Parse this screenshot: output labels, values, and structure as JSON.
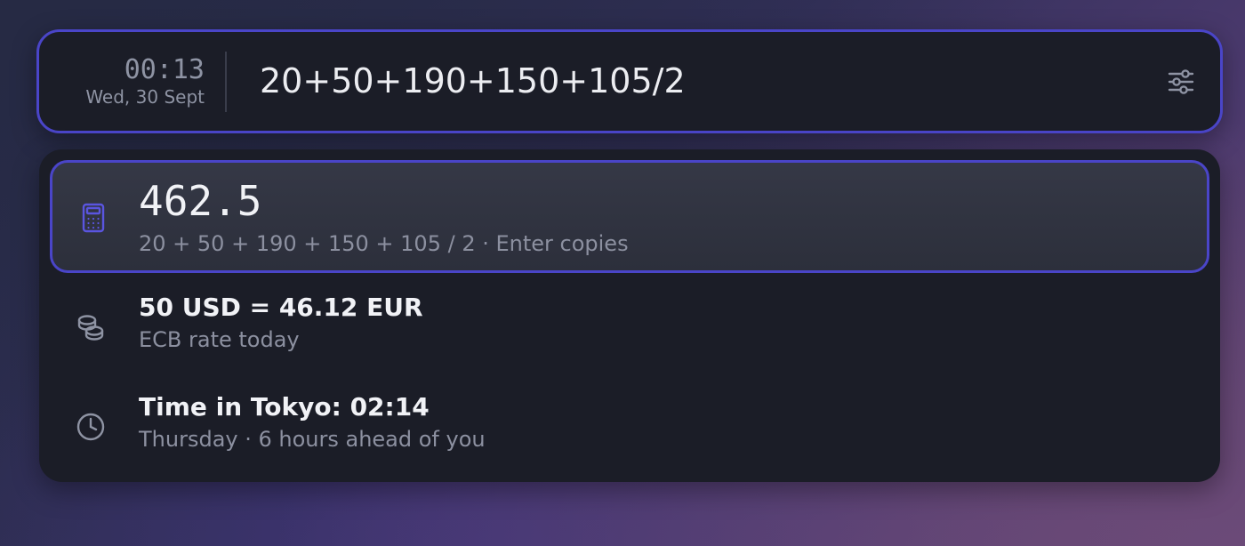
{
  "clock": {
    "time": "00:13",
    "date": "Wed, 30 Sept"
  },
  "search": {
    "query": "20+50+190+150+105/2",
    "settings_icon": "sliders-icon"
  },
  "results": [
    {
      "icon": "calculator-icon",
      "title": "462.5",
      "subtitle": "20 + 50 + 190 + 150 + 105 / 2 · Enter copies",
      "selected": true
    },
    {
      "icon": "coins-icon",
      "title": "50 USD = 46.12 EUR",
      "subtitle": "ECB rate today",
      "selected": false
    },
    {
      "icon": "clock-icon",
      "title": "Time in Tokyo: 02:14",
      "subtitle": "Thursday · 6 hours ahead of you",
      "selected": false
    }
  ],
  "colors": {
    "accent": "#4a45c8",
    "panel": "#1b1d27",
    "selected_bg": "#313441",
    "muted_text": "#8c90a0"
  }
}
